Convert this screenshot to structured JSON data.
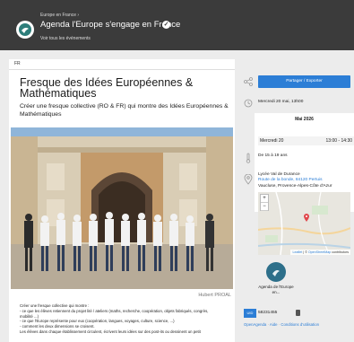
{
  "header": {
    "breadcrumb": "Europe en France ›",
    "title": "Agenda l'Europe s'engage en France",
    "subtitle": "Voir tous les événements"
  },
  "language": "FR",
  "event": {
    "title": "Fresque des Idées Européennes & Mathématiques",
    "lead": "Créer une fresque collective (RO & FR) qui montre des Idées Européennes & Mathématiques",
    "photo_credit": "Hubert PROAL",
    "body_lines": [
      "Créer une fresque collective qui montre :",
      "- ce que les élèves retiennent du projet lité / ateliers (maths, recherche, coopération, objets fabriqués, congrès,",
      "mobilité ...)",
      "- ce que l'Europe représente pour eux (coopération, langues, voyages, culture, science, ...)",
      "- comment les deux dimensions se croisent.",
      "Les élèves dans chaque établissement circulent, écrivent leurs idées sur des post-its ou dessinent un petit"
    ]
  },
  "sidebar": {
    "share_label": "Partager / Exporter",
    "date_summary": "Mercredi 20 mai, 13h00",
    "calendar": {
      "month": "Mai 2026",
      "day": "Mercredi 20",
      "time": "13:00 - 14:30"
    },
    "age": "De 15 à 19 ans",
    "address": {
      "venue": "Lycée Val de Durance",
      "street": "Route de la bonde, 84120 Pertuis",
      "region": "Vaucluse, Provence-Alpes-Côte d'Azur"
    },
    "map": {
      "zoom_in": "+",
      "zoom_out": "−",
      "attrib_leaflet": "Leaflet",
      "attrib_sep": " | © ",
      "attrib_osm": "OpenStreetMap",
      "attrib_rest": " contributors"
    },
    "organizer": "Agenda de l'Europe en...",
    "uid_tag": "UID",
    "uid_code": "58231455",
    "footer": {
      "openagenda": "OpenAgenda",
      "sep1": " · ",
      "help": "Aide",
      "sep2": " · ",
      "terms": "Conditions d'utilisation"
    }
  },
  "colors": {
    "header_bg": "#3b3b3b",
    "accent": "#2c7ed6",
    "logo_teal": "#2d7d7a",
    "marker": "#e0474c"
  }
}
